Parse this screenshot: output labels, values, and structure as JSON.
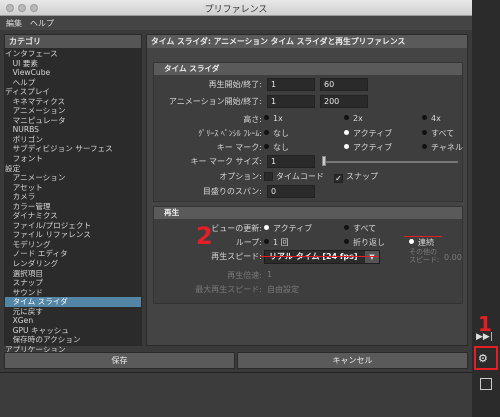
{
  "window": {
    "title": "プリファレンス"
  },
  "menubar": {
    "items": [
      "編集",
      "ヘルプ"
    ]
  },
  "categories": {
    "header": "カテゴリ",
    "items": [
      "インタフェース",
      "　UI 要素",
      "　ViewCube",
      "　ヘルプ",
      "ディスプレイ",
      "　キネマティクス",
      "　アニメーション",
      "　マニピュレータ",
      "　NURBS",
      "　ポリゴン",
      "　サブディビジョン サーフェス",
      "　フォント",
      "設定",
      "　アニメーション",
      "　アセット",
      "　カメラ",
      "　カラー管理",
      "　ダイナミクス",
      "　ファイル/プロジェクト",
      "　ファイル リファレンス",
      "　モデリング",
      "　ノード エディタ",
      "　レンダリング",
      "　選択項目",
      "　スナップ",
      "　サウンド",
      "　タイム スライダ",
      "　元に戻す",
      "　XGen",
      "　GPU キャッシュ",
      "　保存時のアクション",
      "アプリケーション"
    ],
    "selected_index": 26
  },
  "panel": {
    "header": "タイム スライダ: アニメーション タイム スライダと再生プリファレンス",
    "timeslider": {
      "title": "タイム スライダ",
      "playback_range_label": "再生開始/終了:",
      "playback_start": "1",
      "playback_end": "60",
      "anim_range_label": "アニメーション開始/終了:",
      "anim_start": "1",
      "anim_end": "200",
      "height_label": "高さ:",
      "height_options": [
        "1x",
        "2x",
        "4x"
      ],
      "grease_label": "ｸﾞﾘｰｽ ﾍﾟﾝｼﾙ ﾌﾚｰﾑ:",
      "grease_options": [
        "なし",
        "アクティブ",
        "すべて"
      ],
      "keymark_label": "キー マーク:",
      "keymark_options": [
        "なし",
        "アクティブ",
        "チャネル"
      ],
      "keymark_size_label": "キー マーク サイズ:",
      "keymark_size": "1",
      "options_label": "オプション:",
      "timecode_label": "タイムコード",
      "snap_label": "スナップ",
      "span_label": "目盛りのスパン:",
      "span_value": "0"
    },
    "playback": {
      "title": "再生",
      "update_label": "ビューの更新:",
      "update_options": [
        "アクティブ",
        "すべて"
      ],
      "loop_label": "ループ:",
      "loop_options": [
        "1 回",
        "折り返し",
        "連続"
      ],
      "speed_label": "再生スピード:",
      "speed_value": "リアル タイム [24 fps]",
      "other_speed_label": "その他の\nスピード:",
      "other_speed_value": "0.00",
      "multiplier_label": "再生倍速:",
      "multiplier_value": "1",
      "max_speed_label": "最大再生スピード:",
      "max_speed_value": "自由設定"
    }
  },
  "buttons": {
    "save": "保存",
    "cancel": "キャンセル"
  },
  "annotations": {
    "num1": "1",
    "num2": "2"
  },
  "sidebar": {
    "playback_icon_glyph": "▶▶|"
  },
  "colors": {
    "annotation": "#e41e25",
    "selection": "#5285a6"
  }
}
